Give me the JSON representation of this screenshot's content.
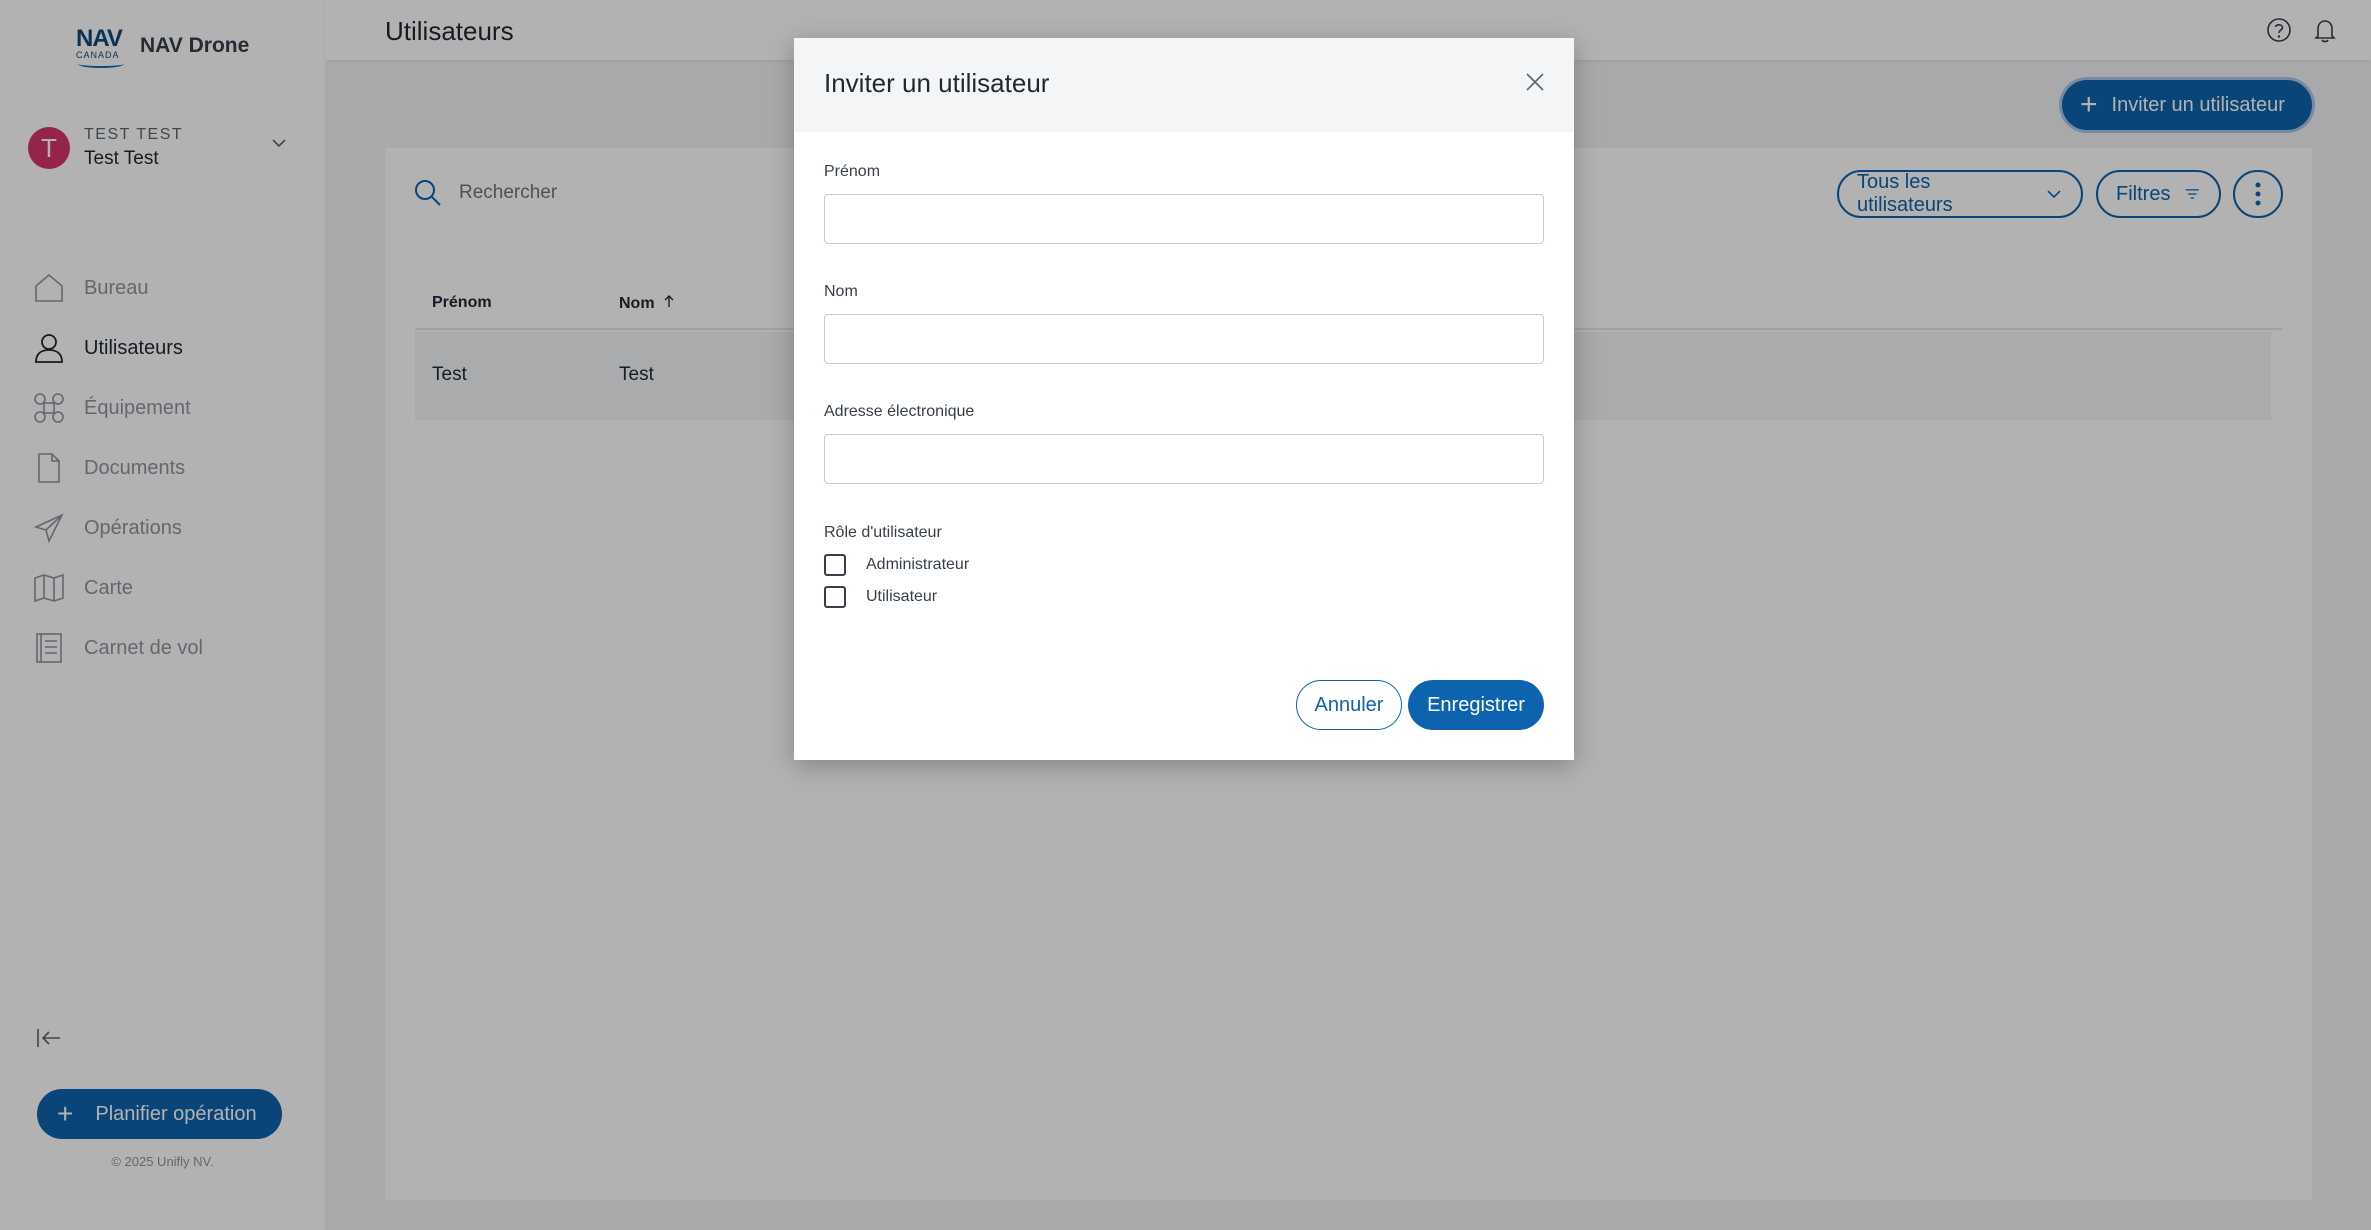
{
  "app": {
    "logo_text": "NAV",
    "logo_subtext": "CANADA",
    "name": "NAV Drone"
  },
  "user": {
    "initial": "T",
    "org": "TEST TEST",
    "name": "Test Test"
  },
  "sidebar": {
    "items": [
      {
        "label": "Bureau",
        "icon": "home-icon"
      },
      {
        "label": "Utilisateurs",
        "icon": "user-icon",
        "active": true
      },
      {
        "label": "Équipement",
        "icon": "drone-icon"
      },
      {
        "label": "Documents",
        "icon": "document-icon"
      },
      {
        "label": "Opérations",
        "icon": "paper-plane-icon"
      },
      {
        "label": "Carte",
        "icon": "map-icon"
      },
      {
        "label": "Carnet de vol",
        "icon": "logbook-icon"
      }
    ],
    "plan_button": "Planifier opération",
    "copyright": "© 2025 Unifly NV."
  },
  "header": {
    "title": "Utilisateurs",
    "invite_button": "Inviter un utilisateur"
  },
  "toolbar": {
    "search_placeholder": "Rechercher",
    "all_users": "Tous les utilisateurs",
    "filters": "Filtres"
  },
  "table": {
    "columns": [
      "Prénom",
      "Nom"
    ],
    "sort_column": "Nom",
    "rows": [
      {
        "first_name": "Test",
        "last_name": "Test"
      }
    ]
  },
  "modal": {
    "title": "Inviter un utilisateur",
    "first_name_label": "Prénom",
    "first_name_value": "",
    "last_name_label": "Nom",
    "last_name_value": "",
    "email_label": "Adresse électronique",
    "email_value": "",
    "role_label": "Rôle d'utilisateur",
    "roles": [
      "Administrateur",
      "Utilisateur"
    ],
    "cancel": "Annuler",
    "save": "Enregistrer"
  },
  "colors": {
    "primary": "#0d63ad",
    "avatar": "#d6346e"
  }
}
